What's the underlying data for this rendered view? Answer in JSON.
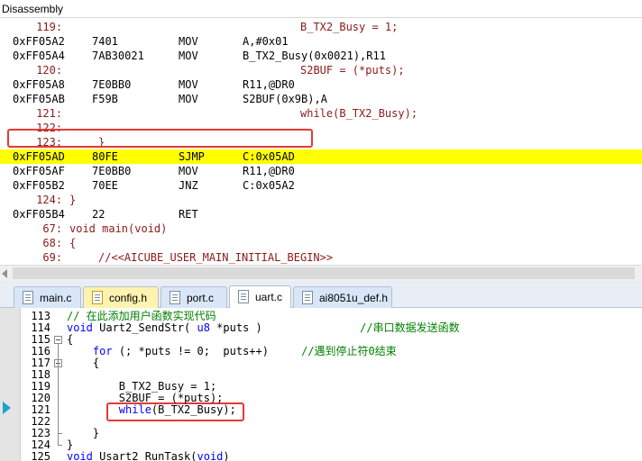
{
  "disassembly": {
    "title": "Disassembly",
    "rows": [
      {
        "kind": "src",
        "num": "119:",
        "text": "B_TX2_Busy = 1;",
        "indent": "wide"
      },
      {
        "kind": "asm",
        "addr": "0xFF05A2",
        "hex": "7401",
        "mnemonic": "MOV",
        "operands": "A,#0x01"
      },
      {
        "kind": "asm",
        "addr": "0xFF05A4",
        "hex": "7AB30021",
        "mnemonic": "MOV",
        "operands": "B_TX2_Busy(0x0021),R11"
      },
      {
        "kind": "src",
        "num": "120:",
        "text": "S2BUF = (*puts);",
        "indent": "wide"
      },
      {
        "kind": "asm",
        "addr": "0xFF05A8",
        "hex": "7E0BB0",
        "mnemonic": "MOV",
        "operands": "R11,@DR0"
      },
      {
        "kind": "asm",
        "addr": "0xFF05AB",
        "hex": "F59B",
        "mnemonic": "MOV",
        "operands": "S2BUF(0x9B),A"
      },
      {
        "kind": "src",
        "num": "121:",
        "text": "while(B_TX2_Busy);",
        "indent": "wide"
      },
      {
        "kind": "src",
        "num": "122:",
        "text": "",
        "indent": "none"
      },
      {
        "kind": "src",
        "num": "123:",
        "text": "}",
        "indent": "small"
      },
      {
        "kind": "asm",
        "addr": "0xFF05AD",
        "hex": "80FE",
        "mnemonic": "SJMP",
        "operands": "C:0x05AD",
        "current": true
      },
      {
        "kind": "asm",
        "addr": "0xFF05AF",
        "hex": "7E0BB0",
        "mnemonic": "MOV",
        "operands": "R11,@DR0"
      },
      {
        "kind": "asm",
        "addr": "0xFF05B2",
        "hex": "70EE",
        "mnemonic": "JNZ",
        "operands": "C:0x05A2"
      },
      {
        "kind": "src",
        "num": "124:",
        "text": "}",
        "indent": "none"
      },
      {
        "kind": "asm",
        "addr": "0xFF05B4",
        "hex": "22",
        "mnemonic": "RET",
        "operands": ""
      },
      {
        "kind": "src",
        "num": "67:",
        "text": "void main(void)",
        "indent": "none"
      },
      {
        "kind": "src",
        "num": "68:",
        "text": "{",
        "indent": "none"
      },
      {
        "kind": "src",
        "num": "69:",
        "text": "//<<AICUBE_USER_MAIN_INITIAL_BEGIN>>",
        "indent": "small"
      }
    ]
  },
  "tabs": [
    {
      "label": "main.c",
      "style": "blue"
    },
    {
      "label": "config.h",
      "style": "yellow"
    },
    {
      "label": "port.c",
      "style": "blue"
    },
    {
      "label": "uart.c",
      "style": "active"
    },
    {
      "label": "ai8051u_def.h",
      "style": "blue"
    }
  ],
  "editor": {
    "lines": [
      {
        "num": "113",
        "code": "// 在此添加用户函数实现代码"
      },
      {
        "num": "114",
        "code": "void Uart2_SendStr( u8 *puts )               //串口数据发送函数"
      },
      {
        "num": "115",
        "code": "{"
      },
      {
        "num": "116",
        "code": "    for (; *puts != 0;  puts++)     //遇到停止符0结束"
      },
      {
        "num": "117",
        "code": "    {"
      },
      {
        "num": "118",
        "code": ""
      },
      {
        "num": "119",
        "code": "        B_TX2_Busy = 1;"
      },
      {
        "num": "120",
        "code": "        S2BUF = (*puts);"
      },
      {
        "num": "121",
        "code": "        while(B_TX2_Busy);"
      },
      {
        "num": "122",
        "code": ""
      },
      {
        "num": "123",
        "code": "    }"
      },
      {
        "num": "124",
        "code": "}"
      },
      {
        "num": "125",
        "code": "void Usart2 RunTask(void)"
      }
    ]
  },
  "colors": {
    "current_line": "#ffff00",
    "highlight_box": "#e53935",
    "source_text": "#8b1a1a",
    "keyword": "#0000ff",
    "comment": "#008000",
    "exec_marker": "#1aa5c8"
  },
  "icons": {
    "tab_file": "file-icon",
    "execution_pointer": "execution-arrow-icon"
  }
}
